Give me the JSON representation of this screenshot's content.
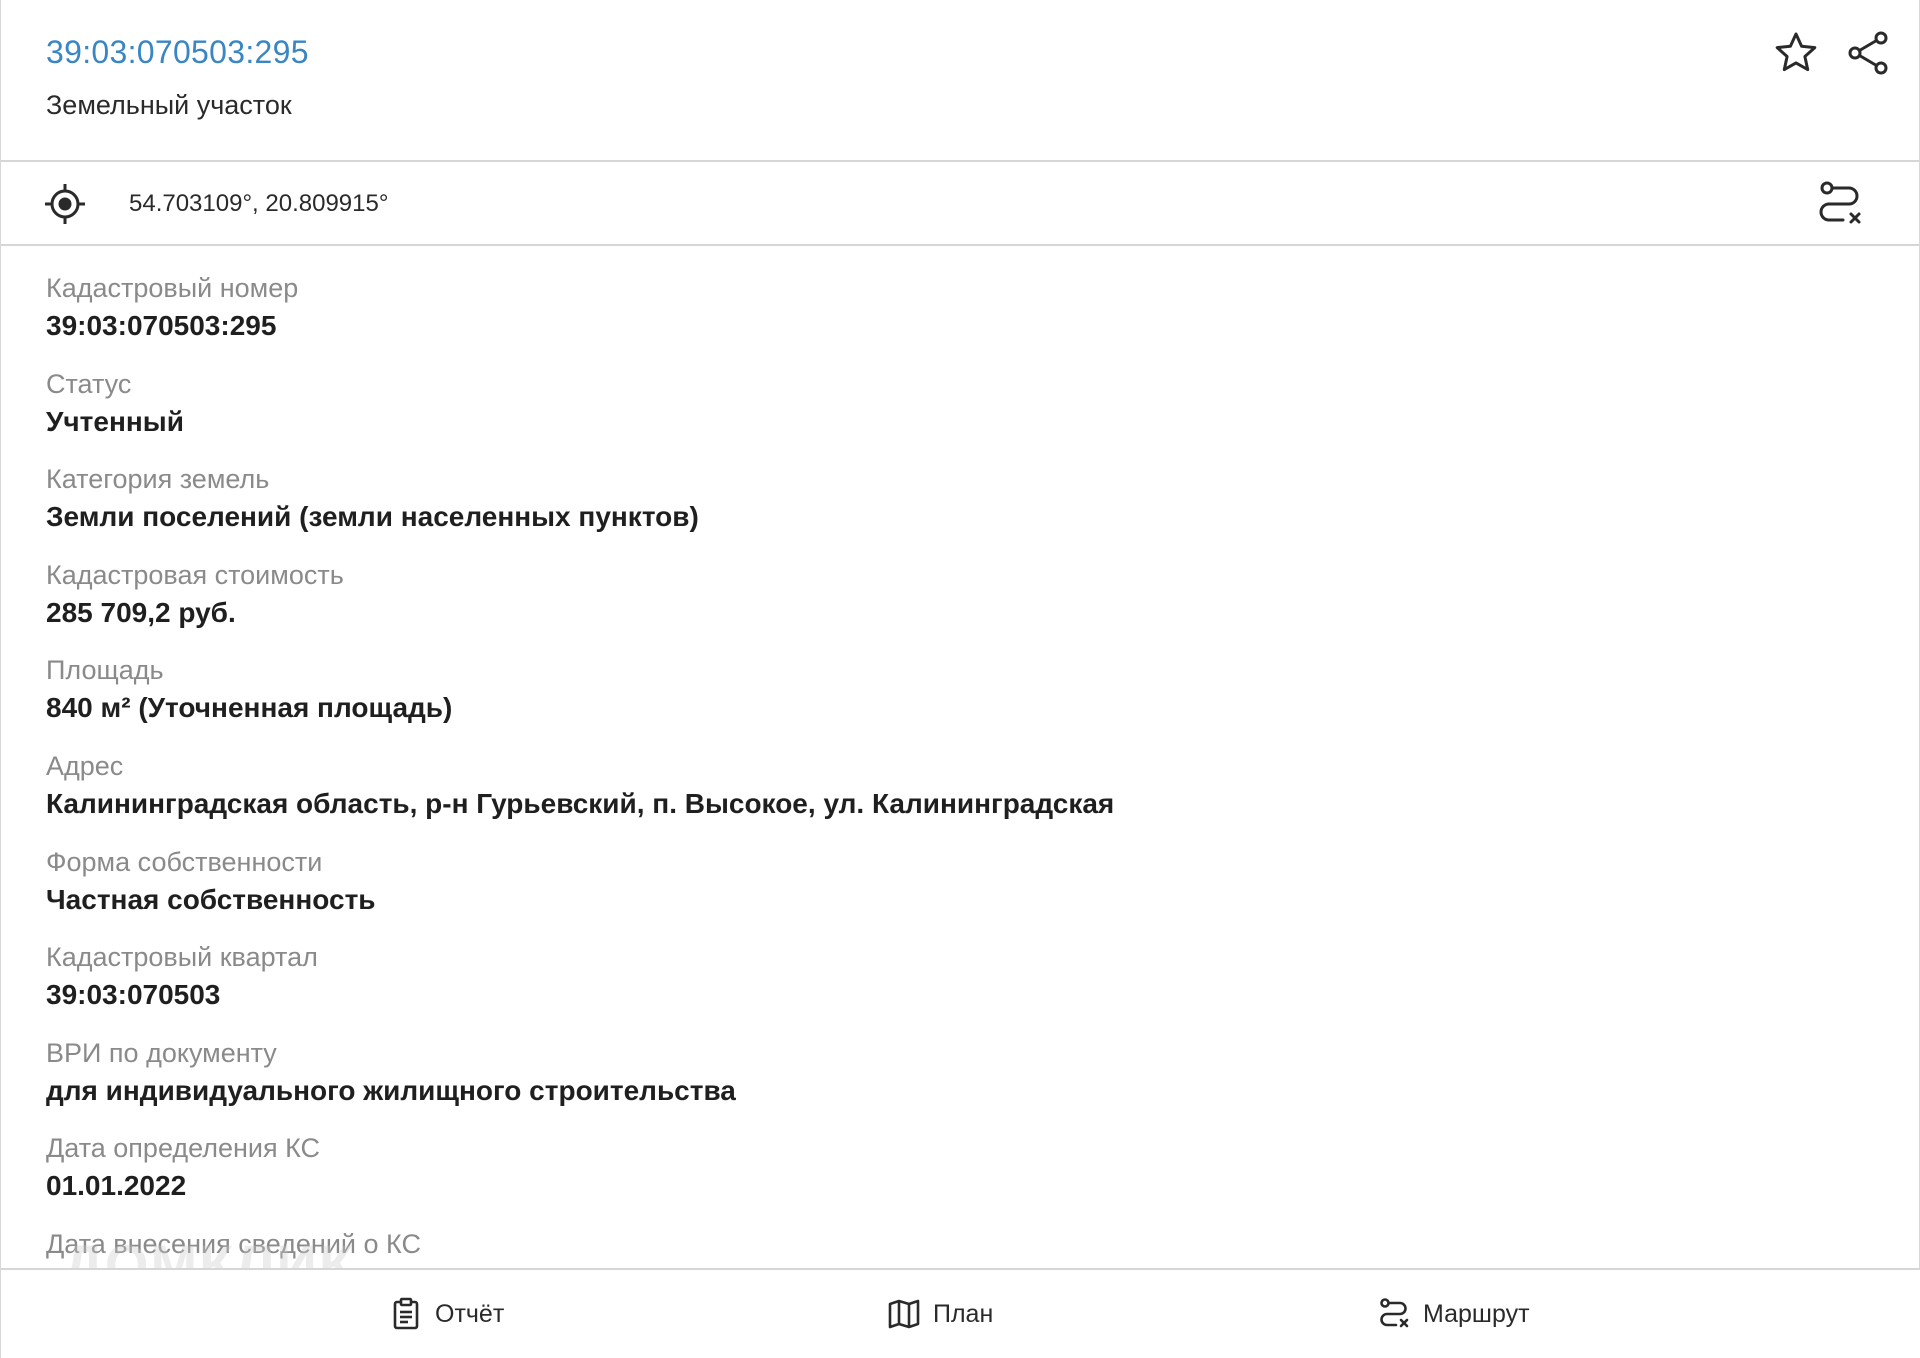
{
  "header": {
    "cadastral_link": "39:03:070503:295",
    "object_type": "Земельный участок",
    "favorite_icon": "star-icon",
    "share_icon": "share-icon"
  },
  "location": {
    "coordinates": "54.703109°, 20.809915°",
    "locate_icon": "crosshair-icon",
    "route_icon": "route-icon"
  },
  "properties": [
    {
      "label": "Кадастровый номер",
      "value": "39:03:070503:295"
    },
    {
      "label": "Статус",
      "value": "Учтенный"
    },
    {
      "label": "Категория земель",
      "value": "Земли поселений (земли населенных пунктов)"
    },
    {
      "label": "Кадастровая стоимость",
      "value": "285 709,2 руб."
    },
    {
      "label": "Площадь",
      "value": "840 м² (Уточненная площадь)"
    },
    {
      "label": "Адрес",
      "value": "Калининградская область, р-н Гурьевский, п. Высокое, ул. Калининградская"
    },
    {
      "label": "Форма собственности",
      "value": "Частная собственность"
    },
    {
      "label": "Кадастровый квартал",
      "value": "39:03:070503"
    },
    {
      "label": "ВРИ по документу",
      "value": "для индивидуального жилищного строительства"
    },
    {
      "label": "Дата определения КС",
      "value": "01.01.2022"
    },
    {
      "label": "Дата внесения сведений о КС",
      "value": ""
    }
  ],
  "bottom_tabs": [
    {
      "label": "Отчёт",
      "icon": "clipboard-icon"
    },
    {
      "label": "План",
      "icon": "map-icon"
    },
    {
      "label": "Маршрут",
      "icon": "route-icon"
    }
  ],
  "watermark": "ДОМКЛИК",
  "colors": {
    "link": "#3a86c4",
    "label": "#8a8a8a",
    "value": "#1f1f1f",
    "divider": "#d6d6d6"
  }
}
